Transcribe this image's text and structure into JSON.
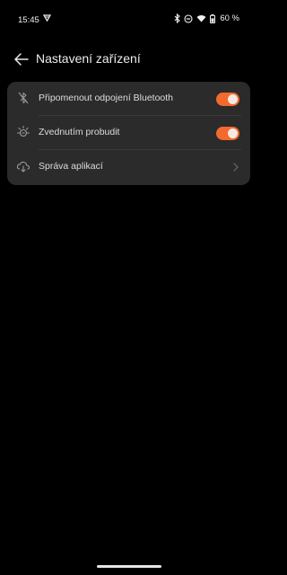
{
  "status_bar": {
    "time": "15:45",
    "battery": "60 %",
    "icons": [
      "network-activity-icon",
      "bluetooth-icon",
      "do-not-disturb-icon",
      "wifi-icon",
      "battery-icon"
    ]
  },
  "header": {
    "title": "Nastavení zařízení",
    "back_icon": "arrow-left-icon"
  },
  "settings": {
    "items": [
      {
        "label": "Připomenout odpojení Bluetooth",
        "icon": "bluetooth-off-icon",
        "control": "toggle",
        "value": true
      },
      {
        "label": "Zvednutím probudit",
        "icon": "raise-to-wake-icon",
        "control": "toggle",
        "value": true
      },
      {
        "label": "Správa aplikací",
        "icon": "cloud-apps-icon",
        "control": "chevron"
      }
    ]
  },
  "colors": {
    "background": "#000000",
    "card": "#2b2b2b",
    "accent": "#f26a2e"
  }
}
